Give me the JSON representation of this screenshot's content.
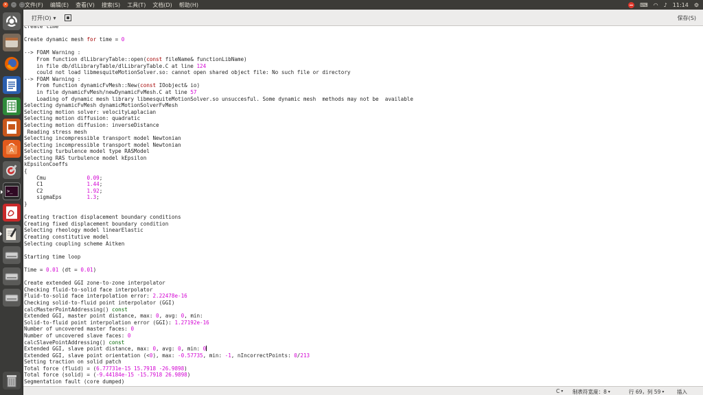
{
  "menubar": {
    "items": [
      "文件(F)",
      "编辑(E)",
      "查看(V)",
      "搜索(S)",
      "工具(T)",
      "文档(D)",
      "帮助(H)"
    ],
    "clock": "11:14"
  },
  "header": {
    "open_label": "打开(O)",
    "open_arrow": "▾",
    "save_label": "保存(S)"
  },
  "editor": {
    "lines": [
      [
        {
          "t": "Create time"
        }
      ],
      [
        {
          "t": ""
        }
      ],
      [
        {
          "t": "Create dynamic mesh "
        },
        {
          "t": "for",
          "c": "kw"
        },
        {
          "t": " time = "
        },
        {
          "t": "0",
          "c": "num"
        }
      ],
      [
        {
          "t": ""
        }
      ],
      [
        {
          "t": "--> FOAM Warning :"
        }
      ],
      [
        {
          "t": "    From function dlLibraryTable::open("
        },
        {
          "t": "const",
          "c": "kw"
        },
        {
          "t": " fileName& functionLibName)"
        }
      ],
      [
        {
          "t": "    in file db/dlLibraryTable/dlLibraryTable.C at line "
        },
        {
          "t": "124",
          "c": "num"
        }
      ],
      [
        {
          "t": "    could not load libmesquiteMotionSolver.so: cannot open shared object file: No such file or directory"
        }
      ],
      [
        {
          "t": "--> FOAM Warning :"
        }
      ],
      [
        {
          "t": "    From function dynamicFvMesh::New("
        },
        {
          "t": "const",
          "c": "kw"
        },
        {
          "t": " IOobject& io)"
        }
      ],
      [
        {
          "t": "    in file dynamicFvMesh/newDynamicFvMesh.C at line "
        },
        {
          "t": "57",
          "c": "num"
        }
      ],
      [
        {
          "t": "    Loading of dynamic mesh library libmesquiteMotionSolver.so unsuccesful. Some dynamic mesh  methods may not be  available"
        }
      ],
      [
        {
          "t": "Selecting dynamicFvMesh dynamicMotionSolverFvMesh"
        }
      ],
      [
        {
          "t": "Selecting motion solver: velocityLaplacian"
        }
      ],
      [
        {
          "t": "Selecting motion diffusion: quadratic"
        }
      ],
      [
        {
          "t": "Selecting motion diffusion: inverseDistance"
        }
      ],
      [
        {
          "t": " Reading stress mesh"
        }
      ],
      [
        {
          "t": "Selecting incompressible transport model Newtonian"
        }
      ],
      [
        {
          "t": "Selecting incompressible transport model Newtonian"
        }
      ],
      [
        {
          "t": "Selecting turbulence model type RASModel"
        }
      ],
      [
        {
          "t": "Selecting RAS turbulence model kEpsilon"
        }
      ],
      [
        {
          "t": "kEpsilonCoeffs"
        }
      ],
      [
        {
          "t": "{"
        }
      ],
      [
        {
          "t": "    Cmu             "
        },
        {
          "t": "0.09",
          "c": "num"
        },
        {
          "t": ";"
        }
      ],
      [
        {
          "t": "    C1              "
        },
        {
          "t": "1.44",
          "c": "num"
        },
        {
          "t": ";"
        }
      ],
      [
        {
          "t": "    C2              "
        },
        {
          "t": "1.92",
          "c": "num"
        },
        {
          "t": ";"
        }
      ],
      [
        {
          "t": "    sigmaEps        "
        },
        {
          "t": "1.3",
          "c": "num"
        },
        {
          "t": ";"
        }
      ],
      [
        {
          "t": "}"
        }
      ],
      [
        {
          "t": ""
        }
      ],
      [
        {
          "t": "Creating traction displacement boundary conditions"
        }
      ],
      [
        {
          "t": "Creating fixed displacement boundary condition"
        }
      ],
      [
        {
          "t": "Selecting rheology model linearElastic"
        }
      ],
      [
        {
          "t": "Creating constitutive model"
        }
      ],
      [
        {
          "t": "Selecting coupling scheme Aitken"
        }
      ],
      [
        {
          "t": ""
        }
      ],
      [
        {
          "t": "Starting time loop"
        }
      ],
      [
        {
          "t": ""
        }
      ],
      [
        {
          "t": "Time = "
        },
        {
          "t": "0.01",
          "c": "num"
        },
        {
          "t": " (dt = "
        },
        {
          "t": "0.01",
          "c": "num"
        },
        {
          "t": ")"
        }
      ],
      [
        {
          "t": ""
        }
      ],
      [
        {
          "t": "Create extended GGI zone-to-zone interpolator"
        }
      ],
      [
        {
          "t": "Checking fluid-to-solid face interpolator"
        }
      ],
      [
        {
          "t": "Fluid-to-solid face interpolation error: "
        },
        {
          "t": "2.22478e-16",
          "c": "num"
        }
      ],
      [
        {
          "t": "Checking solid-to-fluid point interpolator (GGI)"
        }
      ],
      [
        {
          "t": "calcMasterPointAddressing() "
        },
        {
          "t": "const",
          "c": "kw2"
        }
      ],
      [
        {
          "t": "Extended GGI, master point distance, max: "
        },
        {
          "t": "0",
          "c": "num"
        },
        {
          "t": ", avg: "
        },
        {
          "t": "0",
          "c": "num"
        },
        {
          "t": ", min: "
        }
      ],
      [
        {
          "t": "Solid-to-fluid point interpolation error (GGI): "
        },
        {
          "t": "1.27192e-16",
          "c": "num"
        }
      ],
      [
        {
          "t": "Number of uncovered master faces: "
        },
        {
          "t": "0",
          "c": "num"
        }
      ],
      [
        {
          "t": "Number of uncovered slave faces: "
        },
        {
          "t": "0",
          "c": "num"
        }
      ],
      [
        {
          "t": "calcSlavePointAddressing() "
        },
        {
          "t": "const",
          "c": "kw2"
        }
      ],
      [
        {
          "t": "Extended GGI, slave point distance, max: "
        },
        {
          "t": "0",
          "c": "num"
        },
        {
          "t": ", avg: "
        },
        {
          "t": "0",
          "c": "num"
        },
        {
          "t": ", min: "
        },
        {
          "t": "0",
          "c": "num"
        },
        {
          "t": "|",
          "c": "cursor"
        }
      ],
      [
        {
          "t": "Extended GGI, slave point orientation (<"
        },
        {
          "t": "0",
          "c": "num"
        },
        {
          "t": "), max: "
        },
        {
          "t": "-0.57735",
          "c": "num"
        },
        {
          "t": ", min: "
        },
        {
          "t": "-1",
          "c": "num"
        },
        {
          "t": ", nIncorrectPoints: "
        },
        {
          "t": "0",
          "c": "num"
        },
        {
          "t": "/"
        },
        {
          "t": "213",
          "c": "num"
        }
      ],
      [
        {
          "t": "Setting traction on solid patch"
        }
      ],
      [
        {
          "t": "Total force (fluid) = ("
        },
        {
          "t": "6.77731e-15 15.7918 -26.9898",
          "c": "num"
        },
        {
          "t": ")"
        }
      ],
      [
        {
          "t": "Total force (solid) = ("
        },
        {
          "t": "-9.44184e-15 -15.7918 26.9898",
          "c": "num"
        },
        {
          "t": ")"
        }
      ],
      [
        {
          "t": "Segmentation fault (core dumped)"
        }
      ]
    ]
  },
  "statusbar": {
    "language": "C",
    "tab_width": "制表符宽度：8",
    "position": "行 69，列 59",
    "mode": "插入",
    "arrow": "▾"
  },
  "colors": {
    "keyword": "#a40000",
    "number": "#d200d2",
    "const_green": "#006400",
    "launcher_bg": "#3a3a38",
    "topbar_bg": "#3c3b37"
  }
}
